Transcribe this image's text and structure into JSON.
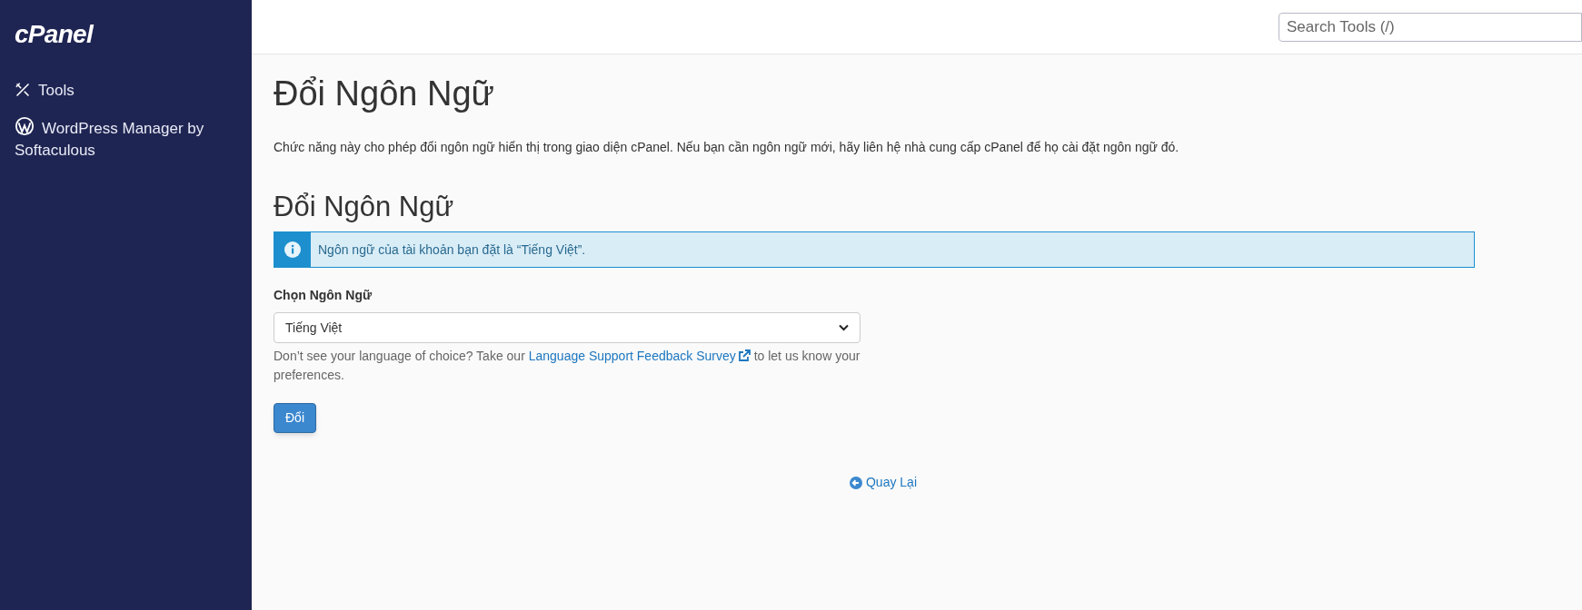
{
  "sidebar": {
    "logo": "cPanel",
    "items": [
      {
        "kind": "tools",
        "label": "Tools"
      },
      {
        "kind": "wordpress",
        "label": "WordPress Manager by Softaculous"
      }
    ]
  },
  "header": {
    "search": {
      "placeholder": "Search Tools (/)"
    }
  },
  "page": {
    "title": "Đổi Ngôn Ngữ",
    "description": "Chức năng này cho phép đổi ngôn ngữ hiển thị trong giao diện cPanel. Nếu bạn cần ngôn ngữ mới, hãy liên hệ nhà cung cấp cPanel để họ cài đặt ngôn ngữ đó.",
    "section_title": "Đổi Ngôn Ngữ",
    "alert": "Ngôn ngữ của tài khoản bạn đặt là “Tiếng Việt”.",
    "select_label": "Chọn Ngôn Ngữ",
    "select_value": "Tiếng Việt",
    "help_before": "Don’t see your language of choice? Take our",
    "help_link": "Language Support Feedback Survey",
    "help_after": "to let us know your preferences.",
    "submit": "Đổi",
    "back": "Quay Lại"
  }
}
